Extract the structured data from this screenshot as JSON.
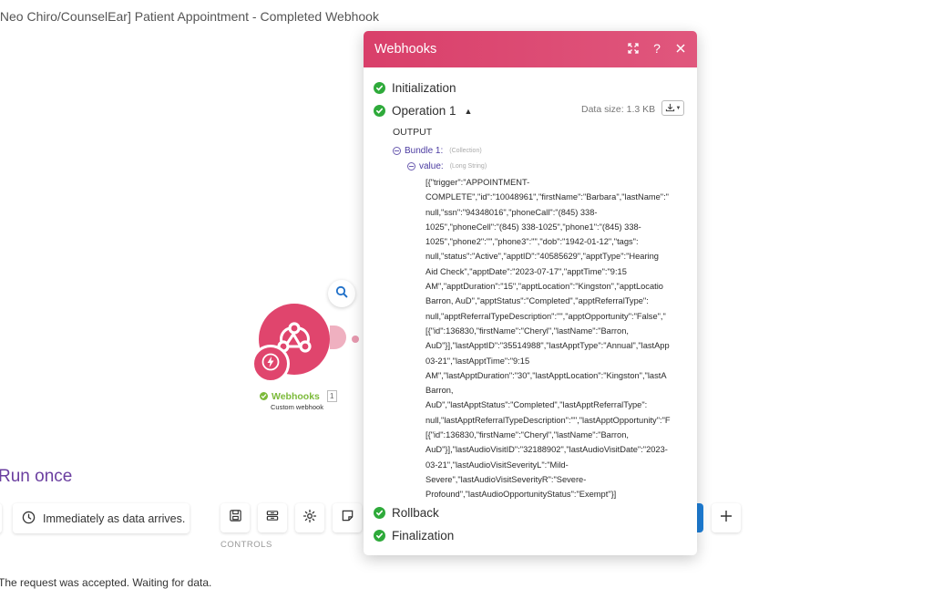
{
  "scenario": {
    "title": "[Neo Chiro/CounselEar] Patient Appointment - Completed Webhook",
    "run_once_label": "Run once",
    "status_message": "The request was accepted. Waiting for data."
  },
  "schedule": {
    "label": "Immediately as data arrives."
  },
  "controls": {
    "label": "CONTROLS",
    "icons": [
      "save-icon",
      "auto-align-icon",
      "settings-icon",
      "notes-icon"
    ]
  },
  "module": {
    "name": "Webhooks",
    "badge": "1",
    "subtitle": "Custom webhook",
    "color": "#e0456d"
  },
  "popup": {
    "title": "Webhooks",
    "header_color": "#d93f6a",
    "steps": {
      "initialization": "Initialization",
      "operation": "Operation 1",
      "rollback": "Rollback",
      "finalization": "Finalization"
    },
    "data_size": "Data size: 1.3 KB",
    "output_label": "OUTPUT",
    "bundle": {
      "label": "Bundle 1:",
      "type": "(Collection)"
    },
    "value": {
      "label": "value:",
      "type": "(Long String)",
      "lines": [
        "[{\"trigger\":\"APPOINTMENT-",
        "COMPLETE\",\"id\":\"10048961\",\"firstName\":\"Barbara\",\"lastName\":\"",
        "null,\"ssn\":\"94348016\",\"phoneCall\":\"(845) 338-",
        "1025\",\"phoneCell\":\"(845) 338-1025\",\"phone1\":\"(845) 338-",
        "1025\",\"phone2\":\"\",\"phone3\":\"\",\"dob\":\"1942-01-12\",\"tags\":",
        "null,\"status\":\"Active\",\"apptID\":\"40585629\",\"apptType\":\"Hearing",
        "Aid Check\",\"apptDate\":\"2023-07-17\",\"apptTime\":\"9:15",
        "AM\",\"apptDuration\":\"15\",\"apptLocation\":\"Kingston\",\"apptLocatio",
        "Barron, AuD\",\"apptStatus\":\"Completed\",\"apptReferralType\":",
        "null,\"apptReferralTypeDescription\":\"\",\"apptOpportunity\":\"False\",\"",
        "[{\"id\":136830,\"firstName\":\"Cheryl\",\"lastName\":\"Barron,",
        "AuD\"}],\"lastApptID\":\"35514988\",\"lastApptType\":\"Annual\",\"lastApp",
        "03-21\",\"lastApptTime\":\"9:15",
        "AM\",\"lastApptDuration\":\"30\",\"lastApptLocation\":\"Kingston\",\"lastA",
        "Barron,",
        "AuD\",\"lastApptStatus\":\"Completed\",\"lastApptReferralType\":",
        "null,\"lastApptReferralTypeDescription\":\"\",\"lastApptOpportunity\":\"F",
        "[{\"id\":136830,\"firstName\":\"Cheryl\",\"lastName\":\"Barron,",
        "AuD\"}],\"lastAudioVisitID\":\"32188902\",\"lastAudioVisitDate\":\"2023-",
        "03-21\",\"lastAudioVisitSeverityL\":\"Mild-",
        "Severe\",\"lastAudioVisitSeverityR\":\"Severe-",
        "Profound\",\"lastAudioOpportunityStatus\":\"Exempt\"}]"
      ]
    }
  }
}
